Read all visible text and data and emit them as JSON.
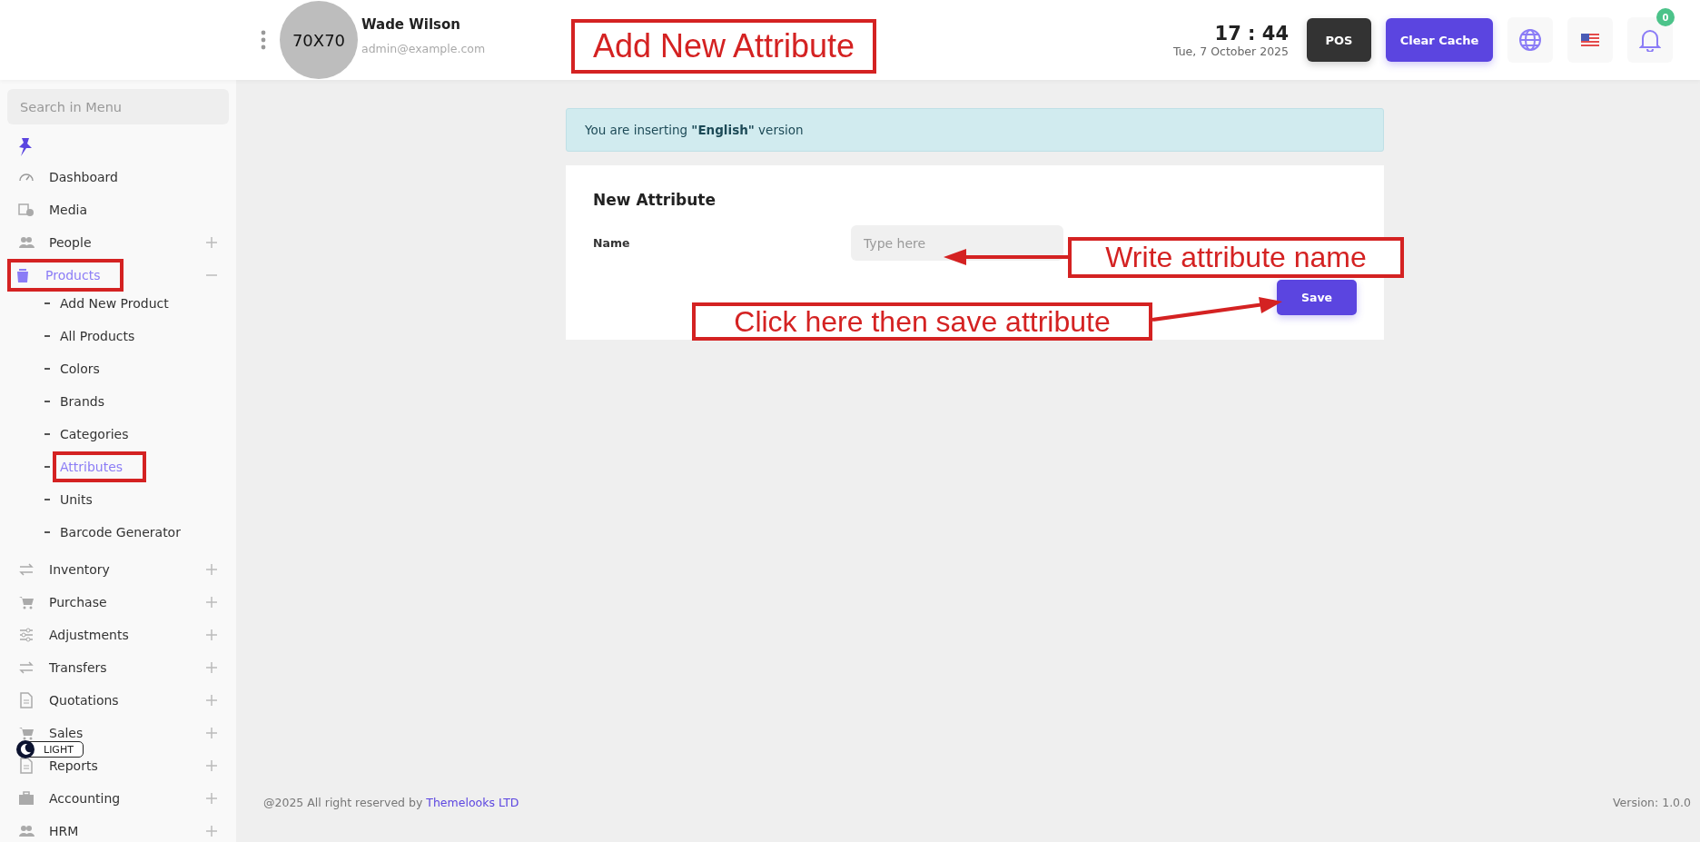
{
  "header": {
    "avatar_text": "70X70",
    "user_name": "Wade Wilson",
    "user_email": "admin@example.com",
    "time": "17 : 44",
    "date": "Tue, 7 October 2025",
    "buttons": [
      {
        "label": "POS",
        "kind": "dark"
      },
      {
        "label": "Clear Cache",
        "kind": "primary"
      }
    ],
    "notification_count": "0"
  },
  "sidebar": {
    "search_placeholder": "Search in Menu",
    "items": [
      {
        "label": "Dashboard",
        "kind": "link",
        "expanded": false,
        "selected": false,
        "highlighted": false
      },
      {
        "label": "Media",
        "kind": "link",
        "expanded": false,
        "selected": false,
        "highlighted": false
      },
      {
        "label": "People",
        "kind": "group",
        "expanded": false,
        "selected": false,
        "highlighted": false
      },
      {
        "label": "Products",
        "kind": "group",
        "expanded": true,
        "selected": true,
        "highlighted": true,
        "children": [
          {
            "label": "Add New Product",
            "selected": false,
            "highlighted": false
          },
          {
            "label": "All Products",
            "selected": false,
            "highlighted": false
          },
          {
            "label": "Colors",
            "selected": false,
            "highlighted": false
          },
          {
            "label": "Brands",
            "selected": false,
            "highlighted": false
          },
          {
            "label": "Categories",
            "selected": false,
            "highlighted": false
          },
          {
            "label": "Attributes",
            "selected": true,
            "highlighted": true
          },
          {
            "label": "Units",
            "selected": false,
            "highlighted": false
          },
          {
            "label": "Barcode Generator",
            "selected": false,
            "highlighted": false
          }
        ]
      },
      {
        "label": "Inventory",
        "kind": "group",
        "expanded": false,
        "selected": false,
        "highlighted": false
      },
      {
        "label": "Purchase",
        "kind": "group",
        "expanded": false,
        "selected": false,
        "highlighted": false
      },
      {
        "label": "Adjustments",
        "kind": "group",
        "expanded": false,
        "selected": false,
        "highlighted": false
      },
      {
        "label": "Transfers",
        "kind": "group",
        "expanded": false,
        "selected": false,
        "highlighted": false
      },
      {
        "label": "Quotations",
        "kind": "group",
        "expanded": false,
        "selected": false,
        "highlighted": false
      },
      {
        "label": "Sales",
        "kind": "group",
        "expanded": false,
        "selected": false,
        "highlighted": false
      },
      {
        "label": "Reports",
        "kind": "group",
        "expanded": false,
        "selected": false,
        "highlighted": false
      },
      {
        "label": "Accounting",
        "kind": "group",
        "expanded": false,
        "selected": false,
        "highlighted": false
      },
      {
        "label": "HRM",
        "kind": "group",
        "expanded": false,
        "selected": false,
        "highlighted": false
      }
    ]
  },
  "theme_toggle": {
    "label": "LIGHT"
  },
  "alert": {
    "text": "You are inserting **\"English\"** version"
  },
  "form": {
    "title": "New Attribute",
    "fields": [
      {
        "label": "Name",
        "placeholder": "Type here"
      }
    ],
    "submit": "Save"
  },
  "footer": {
    "copyright": "@2025 All right reserved by",
    "company_link": "Themelooks LTD",
    "version": "Version: 1.0.0"
  },
  "annotations": [
    {
      "text": "Add New Attribute",
      "arrow": false
    },
    {
      "text": "Write attribute name",
      "arrow": true
    },
    {
      "text": "Click here then save attribute",
      "arrow": true
    }
  ]
}
